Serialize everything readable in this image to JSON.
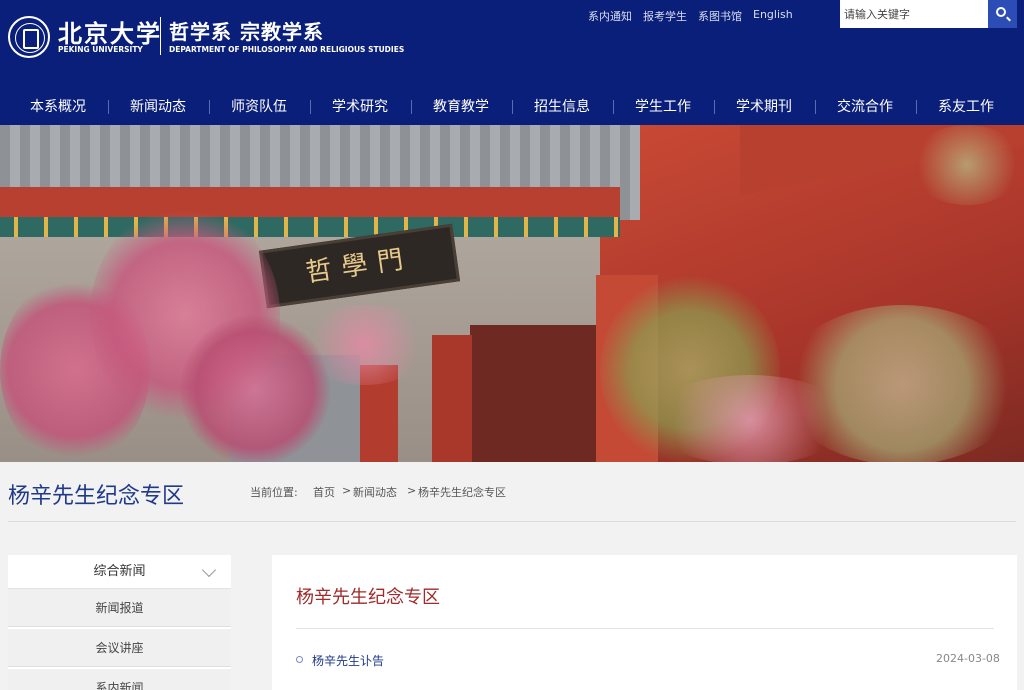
{
  "header": {
    "university_cn": "北京大学",
    "university_en": "PEKING UNIVERSITY",
    "department_cn": "哲学系 宗教学系",
    "department_en": "DEPARTMENT OF PHILOSOPHY AND RELIGIOUS STUDIES",
    "top_links": [
      "系内通知",
      "报考学生",
      "系图书馆",
      "English"
    ],
    "search": {
      "placeholder": "请输入关键字"
    }
  },
  "nav": {
    "items": [
      "本系概况",
      "新闻动态",
      "师资队伍",
      "学术研究",
      "教育教学",
      "招生信息",
      "学生工作",
      "学术期刊",
      "交流合作",
      "系友工作"
    ]
  },
  "banner": {
    "plaque_text": "哲學門"
  },
  "page": {
    "title": "杨辛先生纪念专区",
    "breadcrumb_label": "当前位置:",
    "breadcrumb": [
      "首页",
      ">",
      "新闻动态",
      ">",
      "杨辛先生纪念专区"
    ]
  },
  "sidebar": {
    "heading": "综合新闻",
    "items": [
      "新闻报道",
      "会议讲座",
      "系内新闻"
    ]
  },
  "main": {
    "section_title": "杨辛先生纪念专区",
    "articles": [
      {
        "title": "杨辛先生讣告",
        "date": "2024-03-08"
      }
    ]
  },
  "colors": {
    "header_bg": "#0a1f7a",
    "title_blue": "#1f3a8a",
    "section_red": "#a12a2a",
    "search_button": "#2b4db5"
  }
}
